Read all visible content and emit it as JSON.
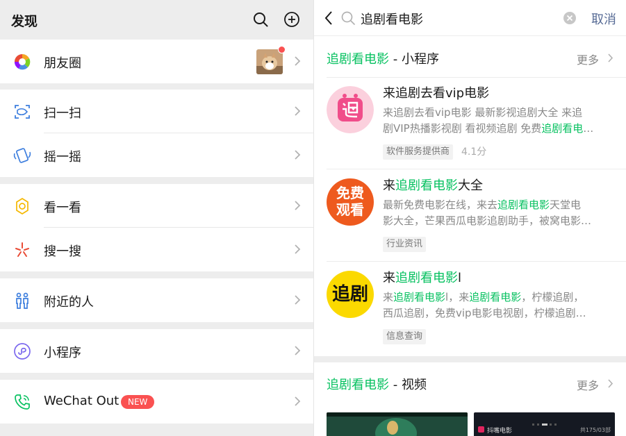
{
  "left": {
    "title": "发现",
    "search_icon": "search-icon",
    "add_icon": "plus-circle-icon",
    "items": [
      {
        "label": "朋友圈",
        "icon": "moments-icon"
      },
      {
        "label": "扫一扫",
        "icon": "scan-icon"
      },
      {
        "label": "摇一摇",
        "icon": "shake-icon"
      },
      {
        "label": "看一看",
        "icon": "top-stories-icon"
      },
      {
        "label": "搜一搜",
        "icon": "search-sparkle-icon"
      },
      {
        "label": "附近的人",
        "icon": "people-nearby-icon"
      },
      {
        "label": "小程序",
        "icon": "mini-program-icon"
      },
      {
        "label": "WeChat Out",
        "icon": "phone-icon",
        "badge": "NEW"
      }
    ]
  },
  "search": {
    "query": "追剧看电影",
    "cancel": "取消"
  },
  "mini_section": {
    "keyword": "追剧看电影",
    "title_suffix": " - 小程序",
    "more": "更多"
  },
  "results": [
    {
      "title_pre": "来追剧去看vip电影",
      "title_hl": "",
      "title_post": "",
      "desc_line1": [
        {
          "t": "来追剧去看vip电影 最新影视追剧大全 来追",
          "h": false
        }
      ],
      "desc_line2": [
        {
          "t": "剧VIP热播影视剧 看视频追剧 免费",
          "h": false
        },
        {
          "t": "追剧看电",
          "h": true
        },
        {
          "t": "…",
          "h": false
        }
      ],
      "tag": "软件服务提供商",
      "rating": "4.1分"
    },
    {
      "title_pre": "来",
      "title_hl": "追剧看电影",
      "title_post": "大全",
      "logo_text": [
        "免费",
        "观看"
      ],
      "desc_line1": [
        {
          "t": "最新免费电影在线，来去",
          "h": false
        },
        {
          "t": "追剧看电影",
          "h": true
        },
        {
          "t": "天堂电",
          "h": false
        }
      ],
      "desc_line2": [
        {
          "t": "影大全，芒果西瓜电影追剧助手，被窝电影…",
          "h": false
        }
      ],
      "tag": "行业资讯"
    },
    {
      "title_pre": "来",
      "title_hl": "追剧看电影",
      "title_post": "l",
      "logo_text": [
        "追剧"
      ],
      "desc_line1": [
        {
          "t": "来",
          "h": false
        },
        {
          "t": "追剧看电影",
          "h": true
        },
        {
          "t": "l，来",
          "h": false
        },
        {
          "t": "追剧看电影",
          "h": true
        },
        {
          "t": "，柠檬追剧，",
          "h": false
        }
      ],
      "desc_line2": [
        {
          "t": "西瓜追剧，免费vip电影电视剧，柠檬追剧…",
          "h": false
        }
      ],
      "tag": "信息查询"
    }
  ],
  "video_section": {
    "keyword": "追剧看电影",
    "title_suffix": " - 视频",
    "more": "更多",
    "thumb_text": "抖嘴电影",
    "thumb_counter": "共175/03部"
  },
  "colors": {
    "highlight": "#07c160",
    "cancel": "#576b95",
    "badge": "#fa5151",
    "bg": "#ededed"
  }
}
